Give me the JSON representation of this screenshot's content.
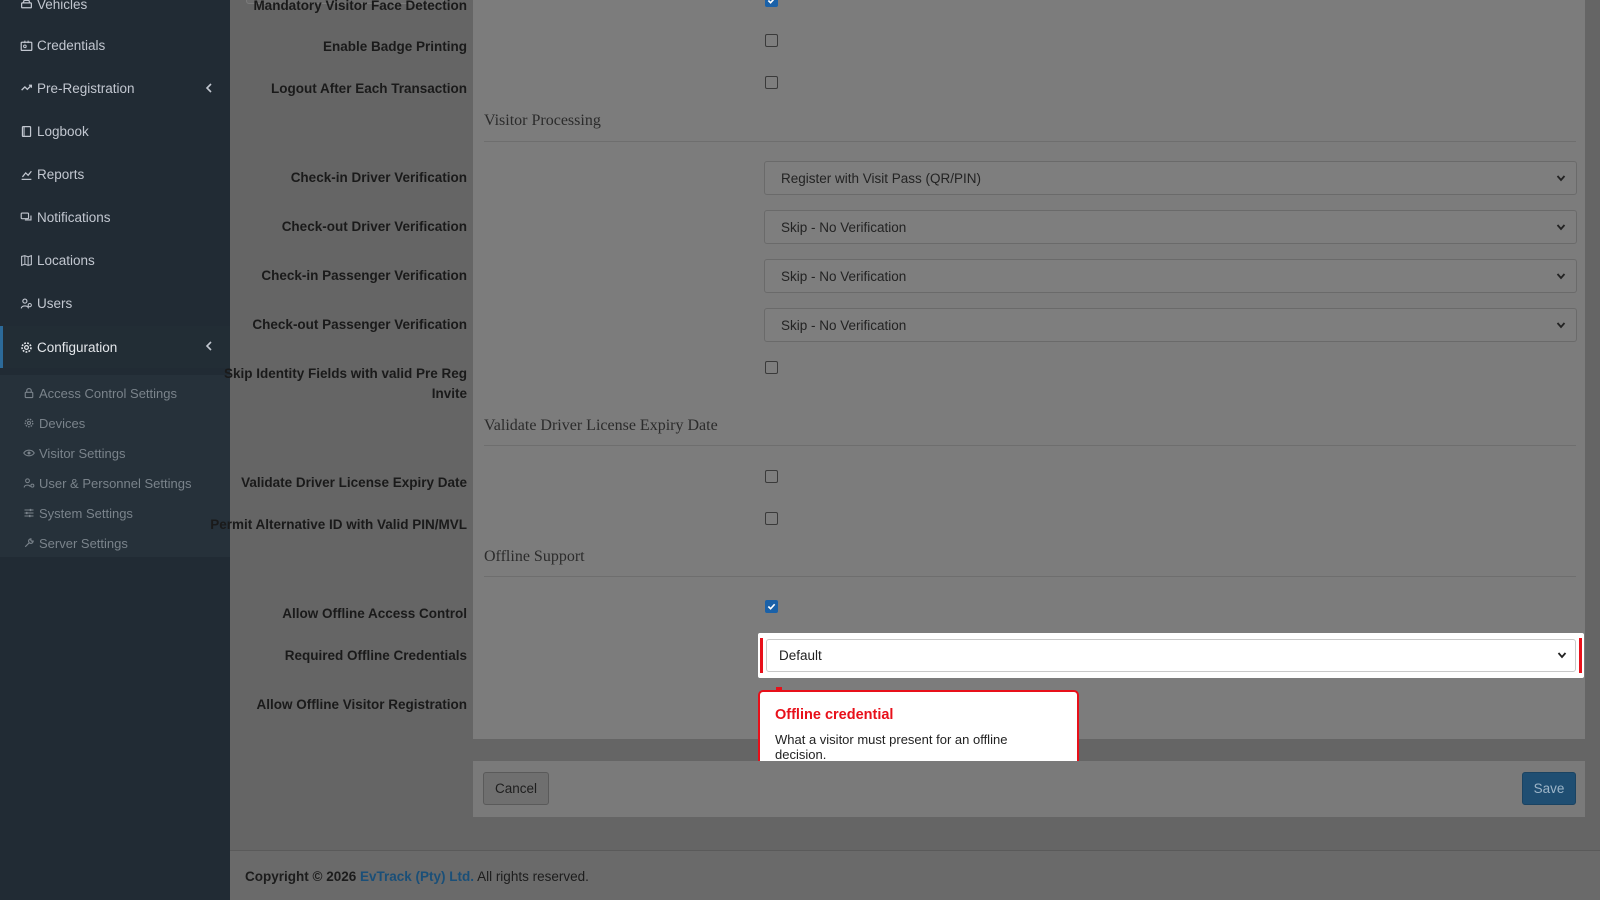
{
  "sidebar": {
    "items": [
      {
        "label": "Vehicles",
        "icon": "car-icon"
      },
      {
        "label": "Credentials",
        "icon": "id-card-icon"
      },
      {
        "label": "Pre-Registration",
        "icon": "exchange-icon"
      },
      {
        "label": "Logbook",
        "icon": "book-icon"
      },
      {
        "label": "Reports",
        "icon": "chart-icon"
      },
      {
        "label": "Notifications",
        "icon": "comments-icon"
      },
      {
        "label": "Locations",
        "icon": "map-icon"
      },
      {
        "label": "Users",
        "icon": "users-icon"
      },
      {
        "label": "Configuration",
        "icon": "gear-icon"
      }
    ],
    "subitems": [
      {
        "label": "Access Control Settings",
        "icon": "lock-icon"
      },
      {
        "label": "Devices",
        "icon": "devices-icon"
      },
      {
        "label": "Visitor Settings",
        "icon": "eye-icon"
      },
      {
        "label": "User & Personnel Settings",
        "icon": "user-cog-icon"
      },
      {
        "label": "System Settings",
        "icon": "sliders-icon"
      },
      {
        "label": "Server Settings",
        "icon": "wrench-icon"
      }
    ]
  },
  "form": {
    "top_fields": [
      {
        "label": "Mandatory Visitor Face Detection",
        "checked": true
      },
      {
        "label": "Enable Badge Printing",
        "checked": false
      },
      {
        "label": "Logout After Each Transaction",
        "checked": false
      }
    ],
    "visitor_processing": {
      "title": "Visitor Processing",
      "selects": [
        {
          "label": "Check-in Driver Verification",
          "value": "Register with Visit Pass (QR/PIN)"
        },
        {
          "label": "Check-out Driver Verification",
          "value": "Skip - No Verification"
        },
        {
          "label": "Check-in Passenger Verification",
          "value": "Skip - No Verification"
        },
        {
          "label": "Check-out Passenger Verification",
          "value": "Skip - No Verification"
        }
      ],
      "skip_identity_label_line1": "Skip Identity Fields with valid Pre Reg",
      "skip_identity_label_line2": "Invite"
    },
    "license": {
      "title": "Validate Driver License Expiry Date",
      "fields": [
        {
          "label": "Validate Driver License Expiry Date",
          "checked": false
        },
        {
          "label": "Permit Alternative ID with Valid PIN/MVL",
          "checked": false
        }
      ]
    },
    "offline": {
      "title": "Offline Support",
      "allow_access_label": "Allow Offline Access Control",
      "allow_access_checked": true,
      "credentials_label": "Required Offline Credentials",
      "credentials_value": "Default",
      "allow_visitor_label": "Allow Offline Visitor Registration"
    }
  },
  "tooltip": {
    "title": "Offline credential",
    "body": "What a visitor must present for an offline decision."
  },
  "buttons": {
    "cancel": "Cancel",
    "save": "Save"
  },
  "footer": {
    "copyright": "Copyright © 2026",
    "company": "EvTrack (Pty) Ltd.",
    "rights": "All rights reserved."
  },
  "colors": {
    "accent": "#e8101a",
    "save": "#1f4e72",
    "sidebar": "#212b34"
  }
}
